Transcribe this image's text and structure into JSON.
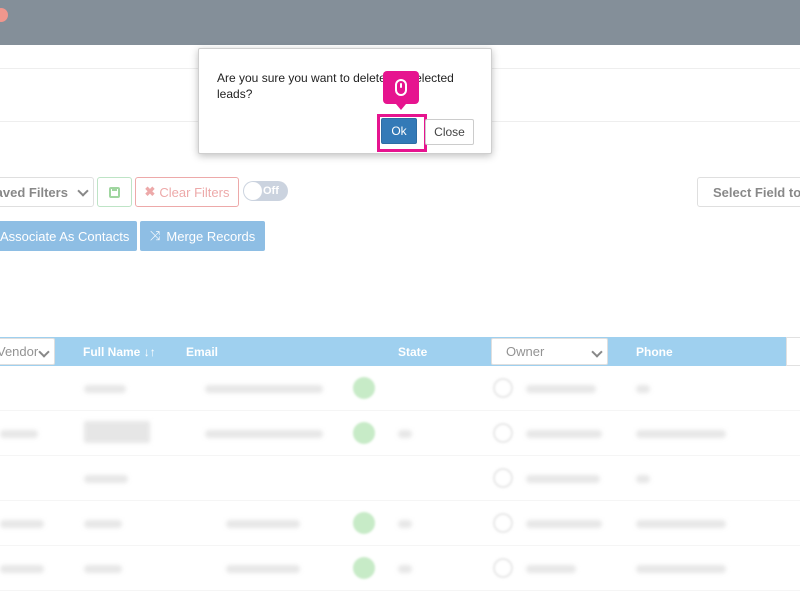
{
  "filters": {
    "saved_filters_label": "Saved Filters",
    "clear_filters_label": "Clear Filters",
    "toggle_label": "Off",
    "select_field_label": "Select Field to"
  },
  "actions": {
    "associate_label": "Associate As Contacts",
    "merge_label": "Merge Records"
  },
  "table": {
    "vendor_select_value": "Vendor",
    "full_name_header": "Full Name",
    "email_header": "Email",
    "state_header": "State",
    "owner_select_value": "Owner",
    "phone_header": "Phone"
  },
  "dialog": {
    "message": "Are you sure you want to delete the selected leads?",
    "ok_label": "Ok",
    "close_label": "Close"
  },
  "colors": {
    "topbar": "#2c3e50",
    "table_header": "#5aaee3",
    "primary_button": "#337ab7",
    "highlight": "#e6148f"
  },
  "icons": {
    "save": "floppy-disk-icon",
    "clear": "times-icon",
    "merge": "random-icon",
    "sort": "sort-icon",
    "cursor": "mouse-icon"
  }
}
